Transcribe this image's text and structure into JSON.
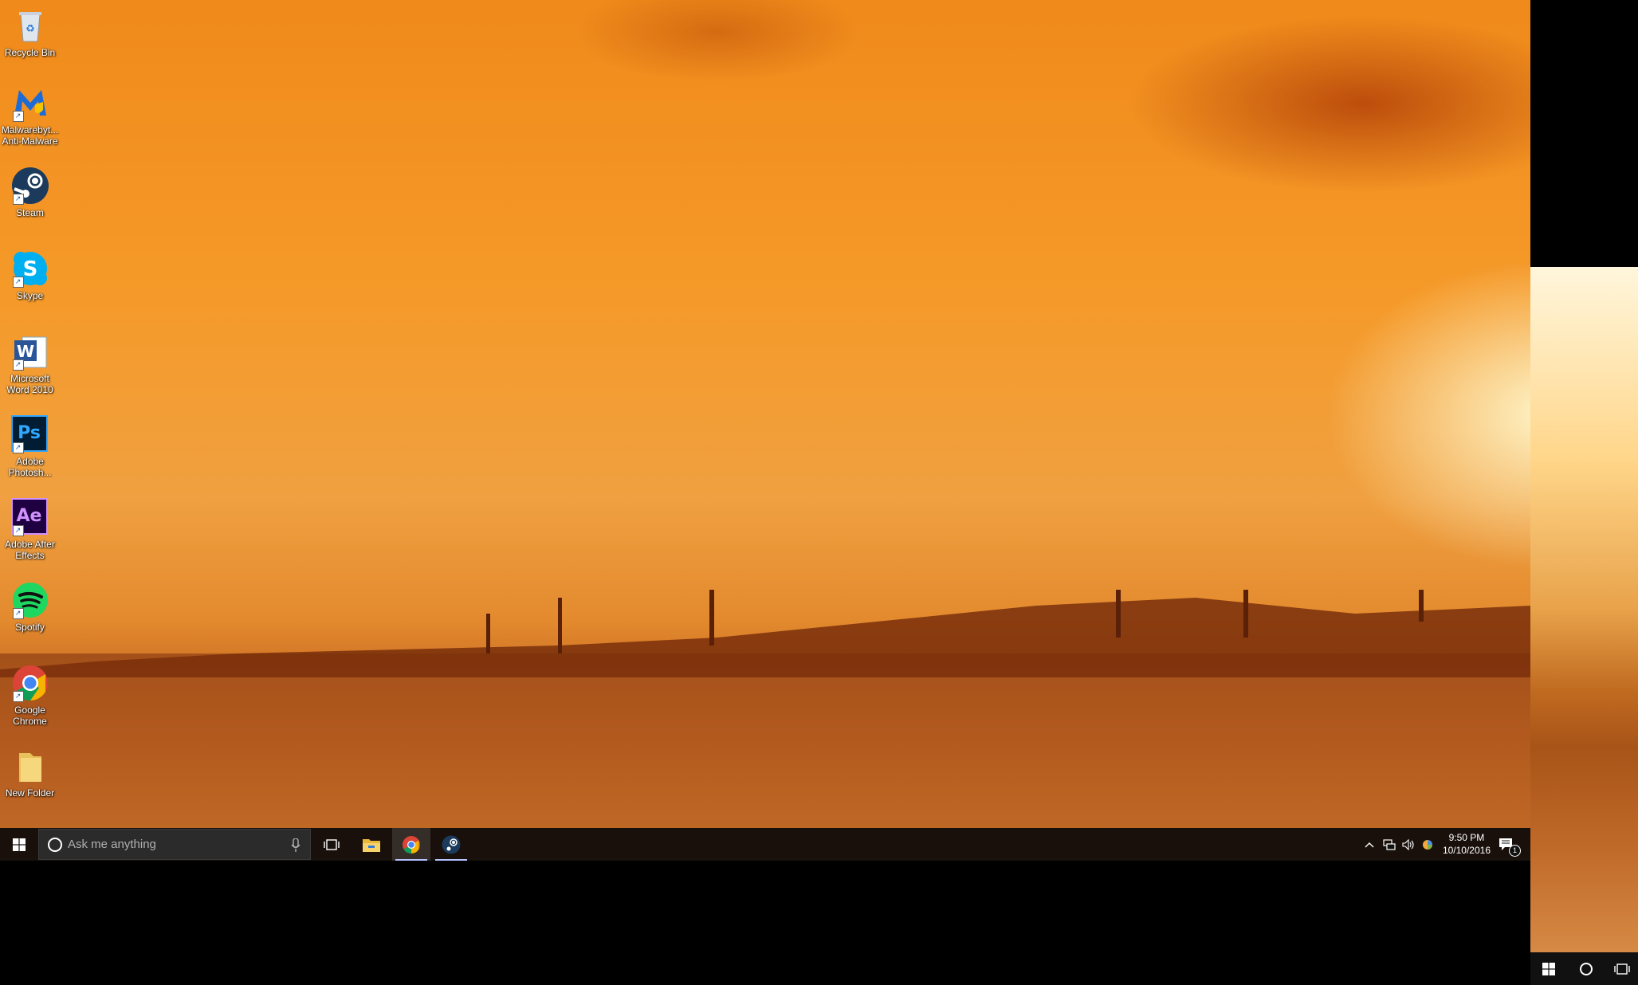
{
  "desktop": {
    "icons": [
      {
        "label": "Recycle Bin",
        "icon": "recycle-bin-icon"
      },
      {
        "label": "Malwarebyt...\nAnti-Malware",
        "icon": "malwarebytes-icon"
      },
      {
        "label": "Steam",
        "icon": "steam-icon"
      },
      {
        "label": "Skype",
        "icon": "skype-icon"
      },
      {
        "label": "Microsoft\nWord 2010",
        "icon": "word-icon"
      },
      {
        "label": "Adobe\nPhotosh...",
        "icon": "photoshop-icon"
      },
      {
        "label": "Adobe After\nEffects",
        "icon": "after-effects-icon"
      },
      {
        "label": "Spotify",
        "icon": "spotify-icon"
      },
      {
        "label": "Google\nChrome",
        "icon": "chrome-icon"
      },
      {
        "label": "New Folder",
        "icon": "folder-icon"
      }
    ],
    "badge_texts": {
      "photoshop": "Ps",
      "after_effects": "Ae",
      "word": "W"
    }
  },
  "taskbar": {
    "search_placeholder": "Ask me anything",
    "pinned": [
      "task-view-icon",
      "file-explorer-icon",
      "chrome-icon",
      "steam-icon"
    ],
    "clock_time": "9:50 PM",
    "clock_date": "10/10/2016",
    "notification_count": "1",
    "tray_icons": [
      "chevron-up-icon",
      "network-icon",
      "volume-icon",
      "color-wheel-icon"
    ]
  },
  "secondary_taskbar": {
    "buttons": [
      "start-icon",
      "cortana-icon",
      "task-view-icon"
    ]
  },
  "colors": {
    "taskbar": "#0c0a0a",
    "search_box": "#2b2b2b",
    "accent": "#b8c4ff"
  }
}
